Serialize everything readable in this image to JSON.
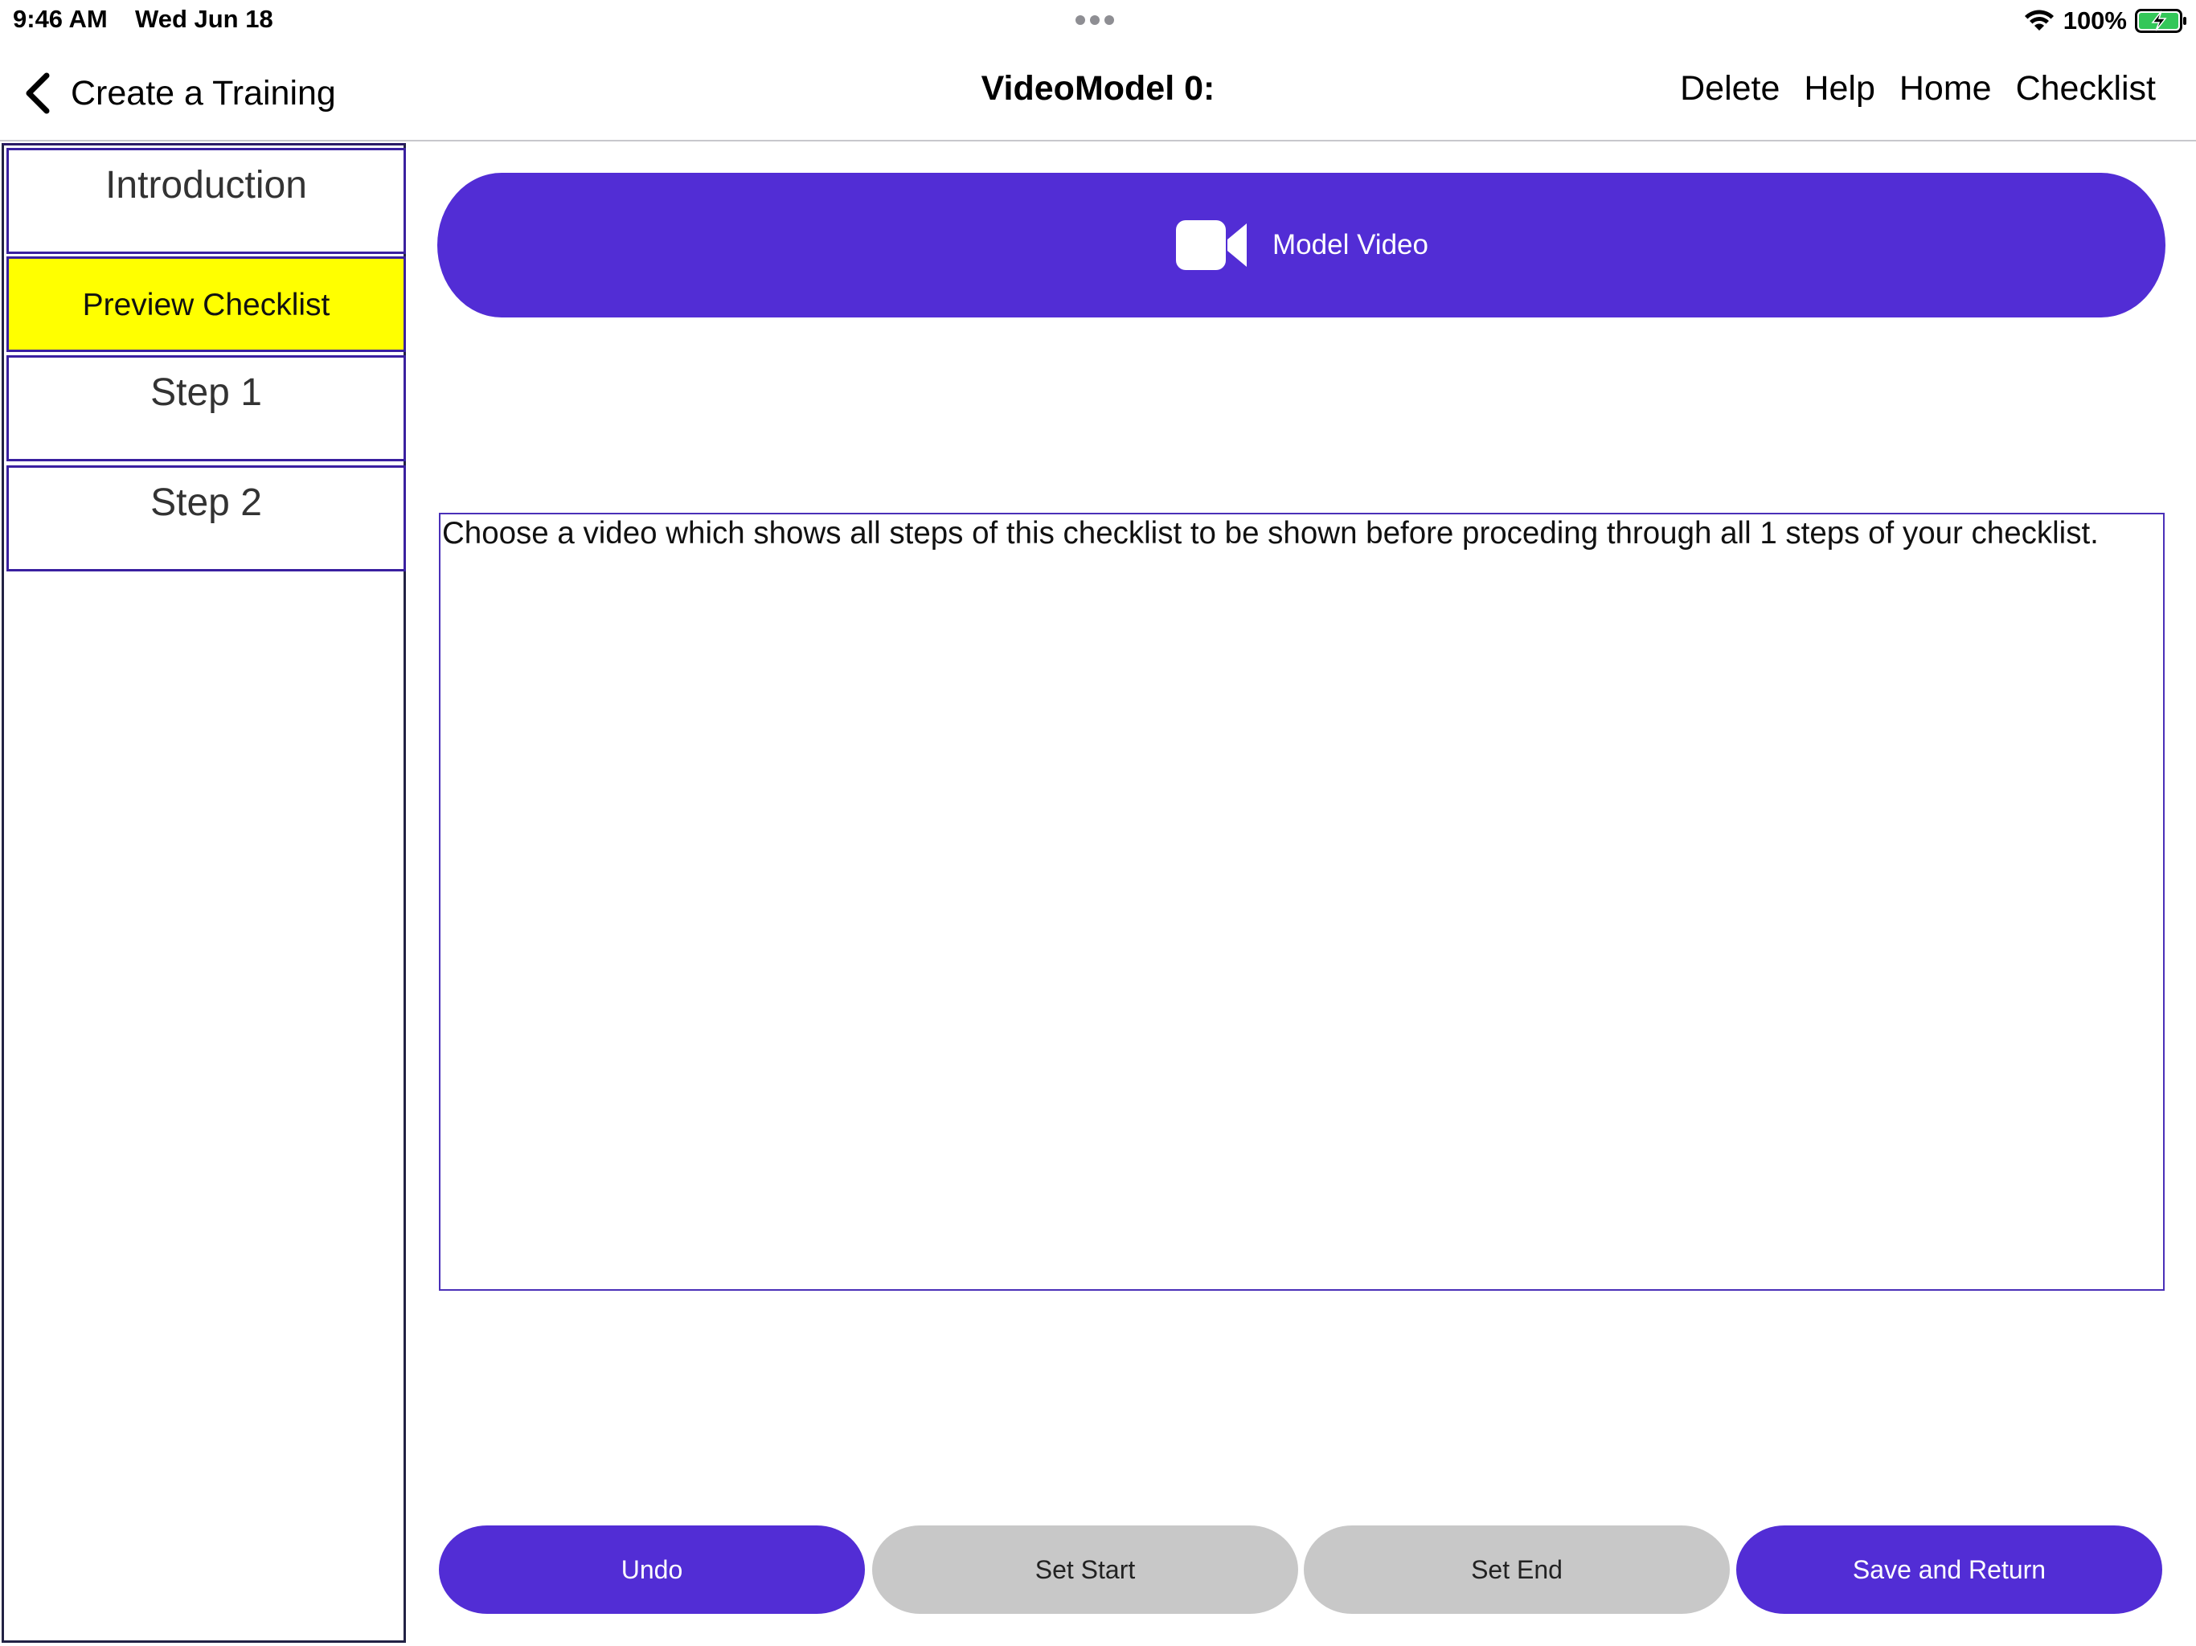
{
  "status_bar": {
    "time": "9:46 AM",
    "date": "Wed Jun 18",
    "battery_percent": "100%",
    "icons": [
      "wifi-icon",
      "battery-charging-icon",
      "multitask-dots-icon"
    ]
  },
  "nav": {
    "back_label": "Create a Training",
    "title": "VideoModel 0:",
    "actions": {
      "delete": "Delete",
      "help": "Help",
      "home": "Home",
      "checklist": "Checklist"
    }
  },
  "sidebar": {
    "items": [
      {
        "label": "Introduction"
      },
      {
        "label": "Preview Checklist",
        "highlight_color": "#ffff00"
      },
      {
        "label": "Step 1"
      },
      {
        "label": "Step 2"
      }
    ]
  },
  "main": {
    "model_video_label": "Model Video",
    "model_video_icon": "video-camera-icon",
    "instructions": "Choose a video which shows all steps of this checklist to be shown before proceding through all 1 steps of your checklist."
  },
  "bottom": {
    "undo": "Undo",
    "set_start": "Set Start",
    "set_end": "Set End",
    "save_and_return": "Save and Return"
  },
  "colors": {
    "accent": "#522dd5",
    "disabled": "#c8c8c8",
    "highlight": "#ffff00",
    "battery_green": "#34c759"
  }
}
